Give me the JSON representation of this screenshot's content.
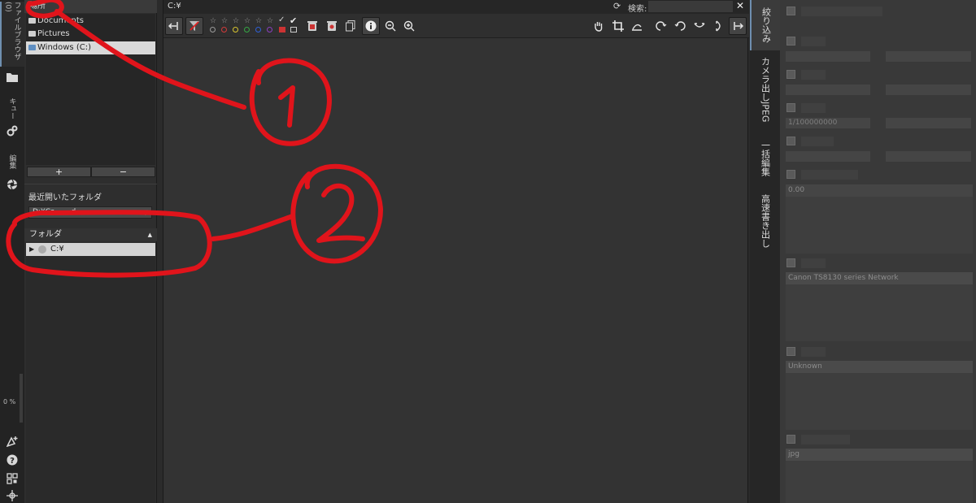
{
  "left_strip": {
    "tabs": [
      {
        "label": "ファイルブラウザ (0)",
        "icon": "folder-icon"
      },
      {
        "label": "キュー",
        "icon": "gears-icon"
      },
      {
        "label": "編集",
        "icon": "aperture-icon"
      }
    ],
    "zoom_readout": "0 %",
    "bottom_icons": [
      "new-window-icon",
      "help-icon",
      "qr-icon",
      "move-icon"
    ]
  },
  "locations": {
    "header": "場所",
    "items": [
      "Documents",
      "Pictures",
      "Windows (C:)"
    ],
    "selected": "Windows (C:)",
    "add_label": "+",
    "remove_label": "−"
  },
  "recent": {
    "header": "最近開いたフォルダ",
    "selected_value": "D:¥Ca... ...d..."
  },
  "folders": {
    "header": "フォルダ",
    "root": "C:¥"
  },
  "center": {
    "path": "C:¥",
    "search_label": "検索:",
    "search_value": "",
    "stars": [
      "☆",
      "☆",
      "☆",
      "☆",
      "☆",
      "☆"
    ],
    "color_labels": [
      "#9a9a9a",
      "#d23a3a",
      "#d8c530",
      "#35a845",
      "#2f5fd6",
      "#8a3fc0"
    ]
  },
  "right_tabs": [
    "絞り込み",
    "カメラ出しJPEG",
    "一括編集",
    "高速書き出し"
  ],
  "filter": {
    "rows": [
      "",
      "",
      "",
      "",
      "",
      ""
    ],
    "values": {
      "field3_left": "1/100000000",
      "exposure_comp": "0.00",
      "camera": "Canon TS8130 series Network",
      "lens": "Unknown",
      "filetype": "jpg"
    }
  },
  "annotations": {
    "one": "①",
    "two": "②",
    "color": "#e0141b"
  }
}
